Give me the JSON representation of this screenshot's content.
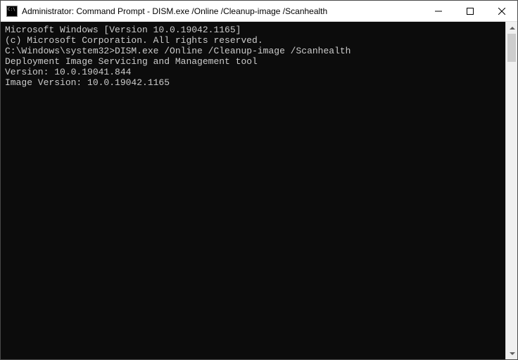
{
  "window": {
    "title": "Administrator: Command Prompt - DISM.exe  /Online /Cleanup-image /Scanhealth"
  },
  "terminal": {
    "line1": "Microsoft Windows [Version 10.0.19042.1165]",
    "line2": "(c) Microsoft Corporation. All rights reserved.",
    "blank1": "",
    "prompt": "C:\\Windows\\system32>",
    "command": "DISM.exe /Online /Cleanup-image /Scanhealth",
    "blank2": "",
    "line3": "Deployment Image Servicing and Management tool",
    "line4": "Version: 10.0.19041.844",
    "blank3": "",
    "line5": "Image Version: 10.0.19042.1165"
  }
}
